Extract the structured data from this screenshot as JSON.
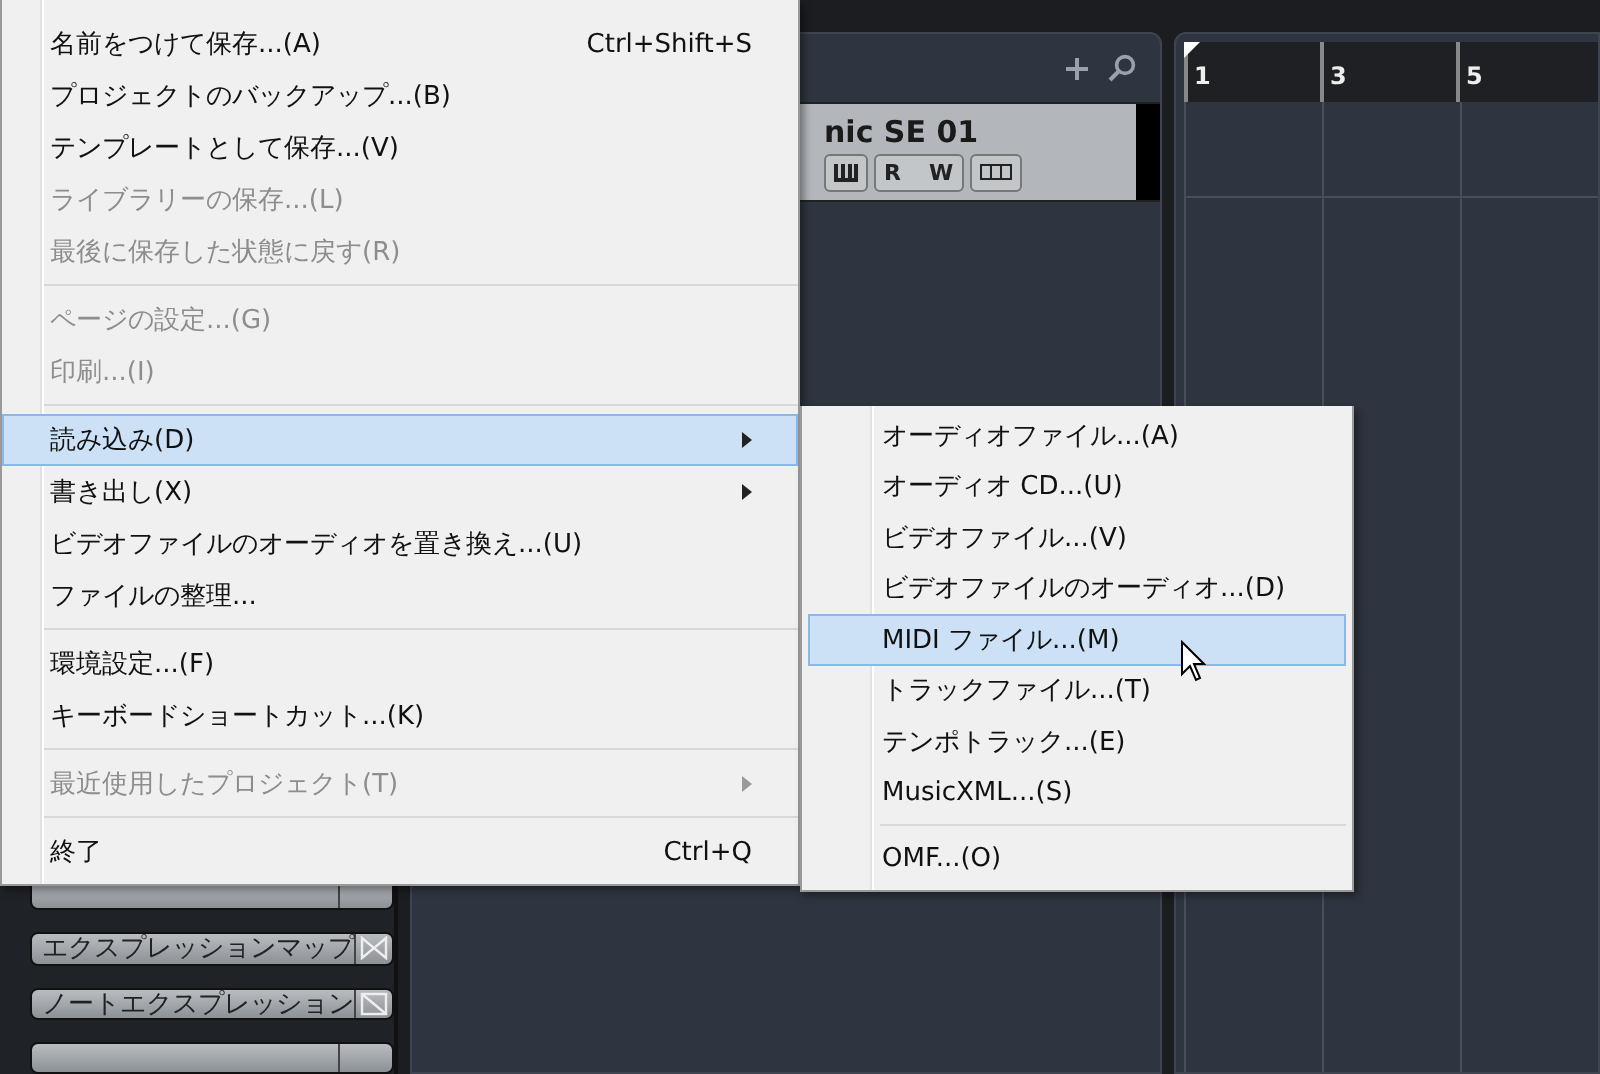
{
  "file_menu": {
    "items": [
      {
        "kind": "item",
        "label": "名前をつけて保存...(A)",
        "shortcut": "Ctrl+Shift+S",
        "disabled": false,
        "selected": false,
        "submenu": false
      },
      {
        "kind": "item",
        "label": "プロジェクトのバックアップ...(B)",
        "disabled": false,
        "selected": false,
        "submenu": false
      },
      {
        "kind": "item",
        "label": "テンプレートとして保存...(V)",
        "disabled": false,
        "selected": false,
        "submenu": false
      },
      {
        "kind": "item",
        "label": "ライブラリーの保存...(L)",
        "disabled": true,
        "selected": false,
        "submenu": false
      },
      {
        "kind": "item",
        "label": "最後に保存した状態に戻す(R)",
        "disabled": true,
        "selected": false,
        "submenu": false
      },
      {
        "kind": "separator"
      },
      {
        "kind": "item",
        "label": "ページの設定...(G)",
        "disabled": true,
        "selected": false,
        "submenu": false
      },
      {
        "kind": "item",
        "label": "印刷...(I)",
        "disabled": true,
        "selected": false,
        "submenu": false
      },
      {
        "kind": "separator"
      },
      {
        "kind": "item",
        "label": "読み込み(D)",
        "disabled": false,
        "selected": true,
        "submenu": true
      },
      {
        "kind": "item",
        "label": "書き出し(X)",
        "disabled": false,
        "selected": false,
        "submenu": true
      },
      {
        "kind": "item",
        "label": "ビデオファイルのオーディオを置き換え...(U)",
        "disabled": false,
        "selected": false,
        "submenu": false
      },
      {
        "kind": "item",
        "label": "ファイルの整理...",
        "disabled": false,
        "selected": false,
        "submenu": false
      },
      {
        "kind": "separator"
      },
      {
        "kind": "item",
        "label": "環境設定...(F)",
        "disabled": false,
        "selected": false,
        "submenu": false
      },
      {
        "kind": "item",
        "label": "キーボードショートカット...(K)",
        "disabled": false,
        "selected": false,
        "submenu": false
      },
      {
        "kind": "separator"
      },
      {
        "kind": "item",
        "label": "最近使用したプロジェクト(T)",
        "disabled": true,
        "selected": false,
        "submenu": true
      },
      {
        "kind": "separator"
      },
      {
        "kind": "item",
        "label": "終了",
        "shortcut": "Ctrl+Q",
        "disabled": false,
        "selected": false,
        "submenu": false
      }
    ]
  },
  "import_submenu": {
    "items": [
      {
        "kind": "item",
        "label": "オーディオファイル...(A)",
        "selected": false
      },
      {
        "kind": "item",
        "label": "オーディオ CD...(U)",
        "selected": false
      },
      {
        "kind": "item",
        "label": "ビデオファイル...(V)",
        "selected": false
      },
      {
        "kind": "item",
        "label": "ビデオファイルのオーディオ...(D)",
        "selected": false
      },
      {
        "kind": "item",
        "label": "MIDI ファイル...(M)",
        "selected": true
      },
      {
        "kind": "item",
        "label": "トラックファイル...(T)",
        "selected": false
      },
      {
        "kind": "item",
        "label": "テンポトラック...(E)",
        "selected": false
      },
      {
        "kind": "item",
        "label": "MusicXML...(S)",
        "selected": false
      },
      {
        "kind": "separator"
      },
      {
        "kind": "item",
        "label": "OMF...(O)",
        "selected": false
      }
    ]
  },
  "track": {
    "name": "nic SE 01",
    "read_label": "R",
    "write_label": "W"
  },
  "ruler": {
    "marks": [
      "1",
      "3",
      "5"
    ]
  },
  "side_buttons": [
    {
      "label": "エクスプレッションマップ"
    },
    {
      "label": "ノートエクスプレッション"
    }
  ]
}
